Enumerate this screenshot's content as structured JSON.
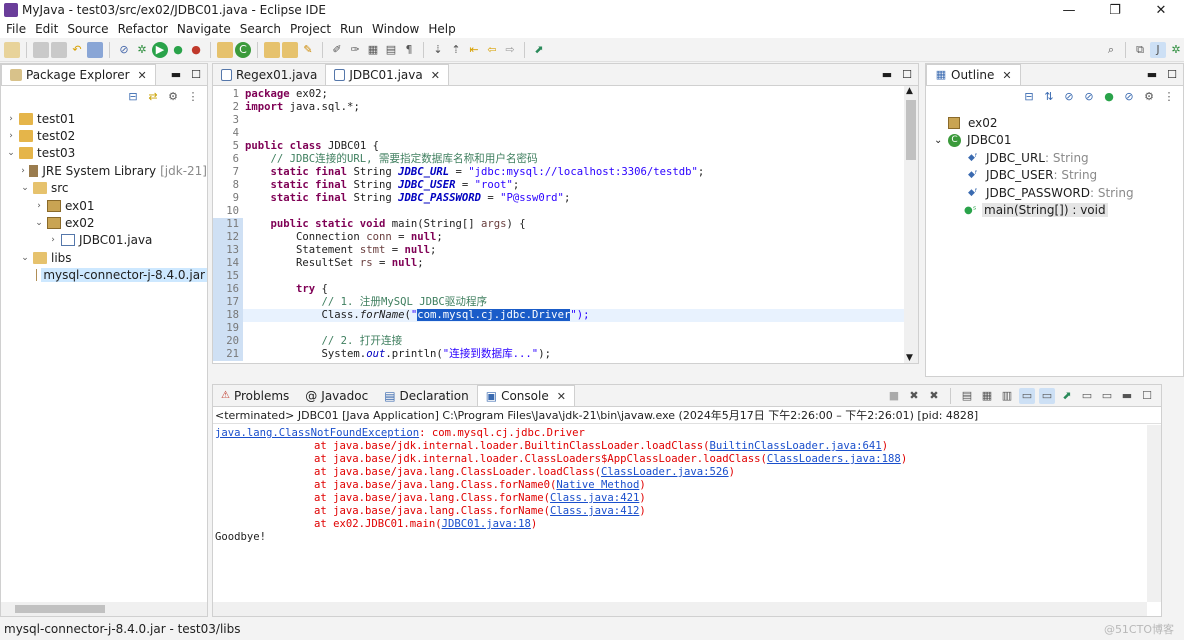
{
  "window": {
    "title": "MyJava - test03/src/ex02/JDBC01.java - Eclipse IDE",
    "minimize": "—",
    "maximize": "❐",
    "close": "✕"
  },
  "menu": [
    "File",
    "Edit",
    "Source",
    "Refactor",
    "Navigate",
    "Search",
    "Project",
    "Run",
    "Window",
    "Help"
  ],
  "package_explorer": {
    "tab_label": "Package Explorer",
    "items": [
      {
        "label": "test01",
        "suffix": ""
      },
      {
        "label": "test02",
        "suffix": ""
      },
      {
        "label": "test03",
        "suffix": ""
      },
      {
        "label": "JRE System Library",
        "suffix": "[jdk-21]"
      },
      {
        "label": "src",
        "suffix": ""
      },
      {
        "label": "ex01",
        "suffix": ""
      },
      {
        "label": "ex02",
        "suffix": ""
      },
      {
        "label": "JDBC01.java",
        "suffix": ""
      },
      {
        "label": "libs",
        "suffix": ""
      },
      {
        "label": "mysql-connector-j-8.4.0.jar",
        "suffix": ""
      }
    ]
  },
  "editor": {
    "tabs": [
      "Regex01.java",
      "JDBC01.java"
    ],
    "line_numbers": [
      "1",
      "2",
      "3",
      "4",
      "5",
      "6",
      "7",
      "8",
      "9",
      "10",
      "11",
      "12",
      "13",
      "14",
      "15",
      "16",
      "17",
      "18",
      "19",
      "20",
      "21"
    ],
    "code": {
      "l1_kw": "package",
      "l1_rest": " ex02;",
      "l2_kw": "import",
      "l2_rest": " java.sql.*;",
      "l5_kw1": "public",
      "l5_kw2": "class",
      "l5_rest": " JDBC01 {",
      "l6_cmt": "    // JDBC连接的URL, 需要指定数据库名称和用户名密码",
      "static_final": "static final",
      "string_type": " String ",
      "l7_const": "JDBC_URL",
      "l7_str": "\"jdbc:mysql://localhost:3306/testdb\"",
      "l8_const": "JDBC_USER",
      "l8_str": "\"root\"",
      "l9_const": "JDBC_PASSWORD",
      "l9_str": "\"P@ssw0rd\"",
      "l11_kw": "public static void",
      "l11_rest": " main(String[] ",
      "l11_var": "args",
      "l11_end": ") {",
      "l12_type": "        Connection ",
      "l12_var": "conn",
      "null": "null",
      "l13_type": "        Statement ",
      "l13_var": "stmt",
      "l14_type": "        ResultSet ",
      "l14_var": "rs",
      "l16_kw": "try",
      "l17_cmt": "            // 1. 注册MySQL JDBC驱动程序",
      "l18_pre": "            Class.",
      "l18_method": "forName",
      "l18_q1": "\"",
      "l18_sel": "com.mysql.cj.jdbc.Driver",
      "l18_q2": "\");",
      "l20_cmt": "            // 2. 打开连接",
      "l21_pre": "            System.",
      "l21_field": "out",
      "l21_mid": ".println(",
      "l21_str": "\"连接到数据库...\"",
      "l21_end": ");"
    }
  },
  "outline": {
    "tab_label": "Outline",
    "items": [
      {
        "label": "ex02",
        "type": ""
      },
      {
        "label": "JDBC01",
        "type": ""
      },
      {
        "label": "JDBC_URL",
        "type": " : String"
      },
      {
        "label": "JDBC_USER",
        "type": " : String"
      },
      {
        "label": "JDBC_PASSWORD",
        "type": " : String"
      },
      {
        "label": "main(String[]) : void",
        "type": ""
      }
    ]
  },
  "bottom_panel": {
    "tabs": [
      "Problems",
      "Javadoc",
      "Declaration",
      "Console"
    ],
    "terminated": "<terminated> JDBC01 [Java Application] C:\\Program Files\\Java\\jdk-21\\bin\\javaw.exe  (2024年5月17日 下午2:26:00 – 下午2:26:01) [pid: 4828]",
    "exception_class": "java.lang.ClassNotFoundException",
    "exception_msg": ": com.mysql.cj.jdbc.Driver",
    "stack": [
      {
        "text": "\tat java.base/jdk.internal.loader.BuiltinClassLoader.loadClass(",
        "link": "BuiltinClassLoader.java:641",
        "end": ")"
      },
      {
        "text": "\tat java.base/jdk.internal.loader.ClassLoaders$AppClassLoader.loadClass(",
        "link": "ClassLoaders.java:188",
        "end": ")"
      },
      {
        "text": "\tat java.base/java.lang.ClassLoader.loadClass(",
        "link": "ClassLoader.java:526",
        "end": ")"
      },
      {
        "text": "\tat java.base/java.lang.Class.forName0(",
        "link": "Native Method",
        "end": ")"
      },
      {
        "text": "\tat java.base/java.lang.Class.forName(",
        "link": "Class.java:421",
        "end": ")"
      },
      {
        "text": "\tat java.base/java.lang.Class.forName(",
        "link": "Class.java:412",
        "end": ")"
      },
      {
        "text": "\tat ex02.JDBC01.main(",
        "link": "JDBC01.java:18",
        "end": ")"
      }
    ],
    "goodbye": "Goodbye!"
  },
  "status_bar": "mysql-connector-j-8.4.0.jar - test03/libs",
  "watermark": "@51CTO博客"
}
